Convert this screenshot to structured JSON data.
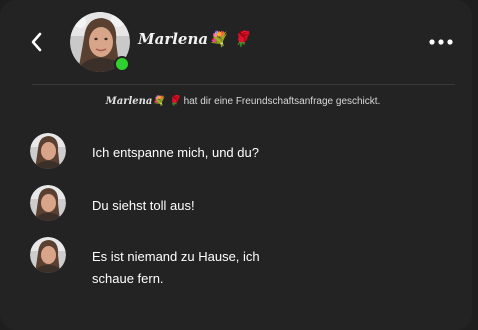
{
  "header": {
    "back_icon": "chevron-left-icon",
    "name": "Marlena💐 🌹",
    "online": true,
    "more_icon": "more-horizontal-icon"
  },
  "notice": {
    "name": "Marlena💐 🌹",
    "text": "hat dir eine Freundschaftsanfrage geschickt."
  },
  "messages": [
    {
      "text": "Ich entspanne mich, und du?"
    },
    {
      "text": "Du siehst toll aus!"
    },
    {
      "text": "Es ist niemand zu Hause, ich schaue fern."
    }
  ],
  "colors": {
    "background": "#232323",
    "online_dot": "#2ed12e",
    "divider": "#3a3a3a"
  }
}
